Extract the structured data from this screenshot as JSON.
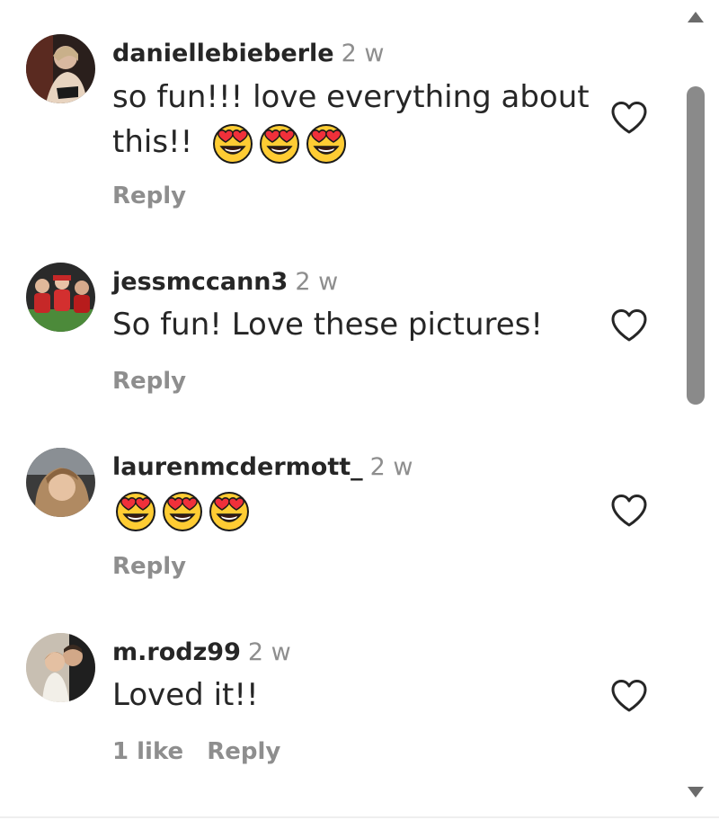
{
  "comments": [
    {
      "username": "daniellebieberle",
      "time": "2 w",
      "text_line1": "so fun!!! love everything about",
      "text_line2": "this!!",
      "emojis": [
        "heart-eyes-emoji",
        "heart-eyes-emoji",
        "heart-eyes-emoji"
      ],
      "reply_label": "Reply"
    },
    {
      "username": "jessmccann3",
      "time": "2 w",
      "text": "So fun! Love these pictures!",
      "reply_label": "Reply"
    },
    {
      "username": "laurenmcdermott_",
      "time": "2 w",
      "emojis": [
        "heart-eyes-emoji",
        "heart-eyes-emoji",
        "heart-eyes-emoji"
      ],
      "reply_label": "Reply"
    },
    {
      "username": "m.rodz99",
      "time": "2 w",
      "text": "Loved it!!",
      "likes_label": "1 like",
      "reply_label": "Reply"
    }
  ],
  "icons": {
    "like": "heart-outline-icon",
    "scroll_up": "triangle-up-icon",
    "scroll_down": "triangle-down-icon"
  },
  "colors": {
    "text": "#262626",
    "muted": "#8e8e8e",
    "scroll_thumb": "#8a8a8a",
    "emoji_face": "#ffcc33",
    "emoji_heart": "#f0303a"
  }
}
